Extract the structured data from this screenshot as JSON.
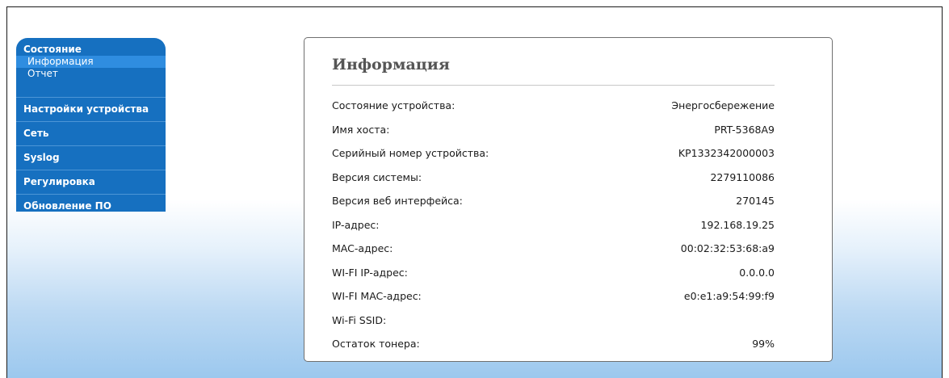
{
  "sidebar": {
    "group_title": "Состояние",
    "sub_items": [
      {
        "label": "Информация",
        "active": true
      },
      {
        "label": "Отчет",
        "active": false
      }
    ],
    "items": [
      {
        "label": "Настройки устройства"
      },
      {
        "label": "Сеть"
      },
      {
        "label": "Syslog"
      },
      {
        "label": "Регулировка"
      },
      {
        "label": "Обновление ПО"
      }
    ]
  },
  "main": {
    "title": "Информация",
    "rows": [
      {
        "label": "Состояние устройства:",
        "value": "Энергосбережение"
      },
      {
        "label": "Имя хоста:",
        "value": "PRT-5368A9"
      },
      {
        "label": "Серийный номер устройства:",
        "value": "KP1332342000003"
      },
      {
        "label": "Версия системы:",
        "value": "2279110086"
      },
      {
        "label": "Версия веб интерфейса:",
        "value": "270145"
      },
      {
        "label": "IP-адрес:",
        "value": "192.168.19.25"
      },
      {
        "label": "MAC-адрес:",
        "value": "00:02:32:53:68:a9"
      },
      {
        "label": "WI-FI IP-адрес:",
        "value": "0.0.0.0"
      },
      {
        "label": "WI-FI MAC-адрес:",
        "value": "e0:e1:a9:54:99:f9"
      },
      {
        "label": "Wi-Fi SSID:",
        "value": ""
      },
      {
        "label": "Остаток тонера:",
        "value": "99%"
      }
    ]
  },
  "colors": {
    "sidebar_bg": "#1670c0",
    "sidebar_active": "#2f8de0",
    "background_gradient_bottom": "#9cc8ee"
  }
}
